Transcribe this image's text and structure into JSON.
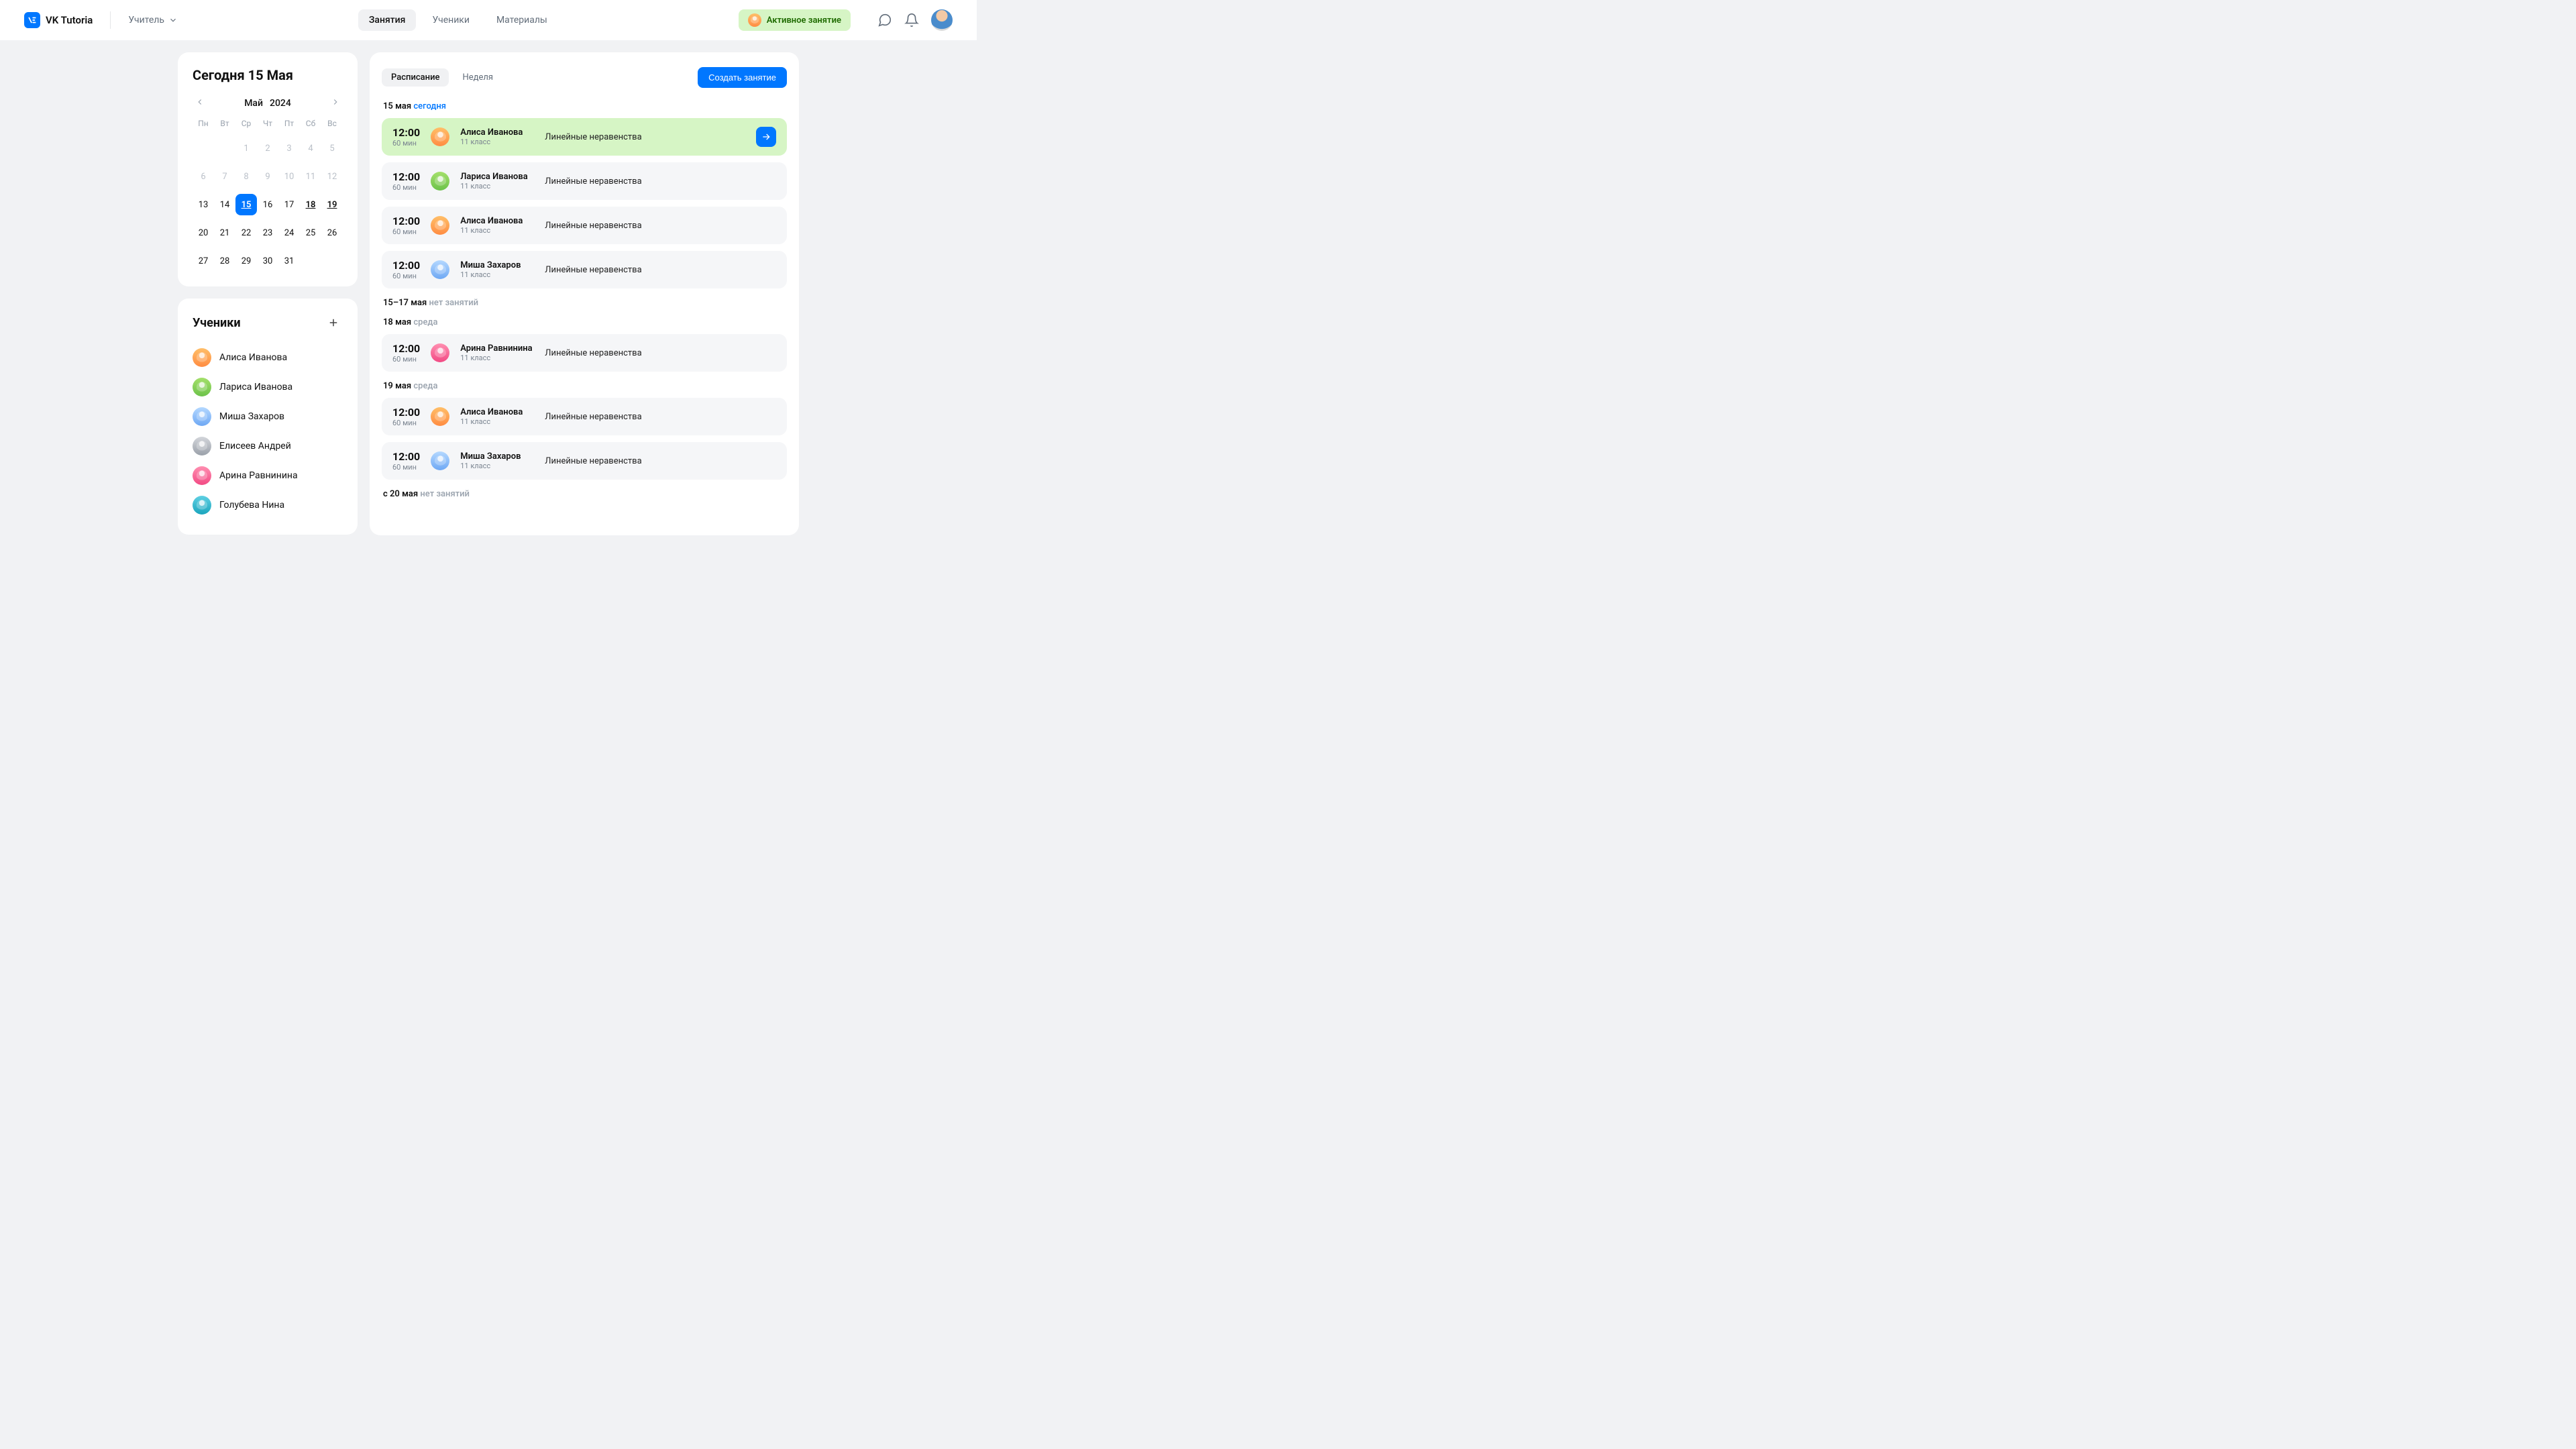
{
  "header": {
    "brand": "VK Tutoria",
    "role_label": "Учитель",
    "nav": [
      {
        "label": "Занятия",
        "active": true
      },
      {
        "label": "Ученики",
        "active": false
      },
      {
        "label": "Материалы",
        "active": false
      }
    ],
    "active_lesson_label": "Активное занятие"
  },
  "calendar": {
    "today_title": "Сегодня 15 Мая",
    "month": "Май",
    "year": "2024",
    "dow": [
      "Пн",
      "Вт",
      "Ср",
      "Чт",
      "Пт",
      "Сб",
      "Вс"
    ],
    "leading_blanks": 2,
    "days": 31,
    "selected": 15,
    "marked": [
      18,
      19
    ]
  },
  "students": {
    "title": "Ученики",
    "list": [
      {
        "name": "Алиса Иванова",
        "avatar": "av-orange"
      },
      {
        "name": "Лариса Иванова",
        "avatar": "av-green"
      },
      {
        "name": "Миша Захаров",
        "avatar": "av-blue"
      },
      {
        "name": "Елисеев Андрей",
        "avatar": "av-grey"
      },
      {
        "name": "Арина Равнинина",
        "avatar": "av-pink"
      },
      {
        "name": "Голубева Нина",
        "avatar": "av-teal"
      }
    ]
  },
  "schedule": {
    "tabs": [
      {
        "label": "Расписание",
        "active": true
      },
      {
        "label": "Неделя",
        "active": false
      }
    ],
    "create_label": "Создать занятие",
    "groups": [
      {
        "label_main": "15 мая",
        "label_accent": "сегодня",
        "lessons": [
          {
            "time": "12:00",
            "dur": "60 мин",
            "student": "Алиса Иванова",
            "klass": "11 класс",
            "topic": "Линейные неравенства",
            "avatar": "av-orange",
            "highlight": true,
            "go": true
          },
          {
            "time": "12:00",
            "dur": "60 мин",
            "student": "Лариса Иванова",
            "klass": "11 класс",
            "topic": "Линейные неравенства",
            "avatar": "av-green"
          },
          {
            "time": "12:00",
            "dur": "60 мин",
            "student": "Алиса Иванова",
            "klass": "11 класс",
            "topic": "Линейные неравенства",
            "avatar": "av-orange"
          },
          {
            "time": "12:00",
            "dur": "60 мин",
            "student": "Миша Захаров",
            "klass": "11 класс",
            "topic": "Линейные неравенства",
            "avatar": "av-blue"
          }
        ]
      },
      {
        "label_main": "15–17 мая",
        "label_muted": "нет занятий",
        "lessons": []
      },
      {
        "label_main": "18 мая",
        "label_muted": "среда",
        "lessons": [
          {
            "time": "12:00",
            "dur": "60 мин",
            "student": "Арина Равнинина",
            "klass": "11 класс",
            "topic": "Линейные неравенства",
            "avatar": "av-pink"
          }
        ]
      },
      {
        "label_main": "19 мая",
        "label_muted": "среда",
        "lessons": [
          {
            "time": "12:00",
            "dur": "60 мин",
            "student": "Алиса Иванова",
            "klass": "11 класс",
            "topic": "Линейные неравенства",
            "avatar": "av-orange"
          },
          {
            "time": "12:00",
            "dur": "60 мин",
            "student": "Миша Захаров",
            "klass": "11 класс",
            "topic": "Линейные неравенства",
            "avatar": "av-blue"
          }
        ]
      },
      {
        "label_main": "с 20 мая",
        "label_muted": "нет занятий",
        "lessons": []
      }
    ]
  }
}
